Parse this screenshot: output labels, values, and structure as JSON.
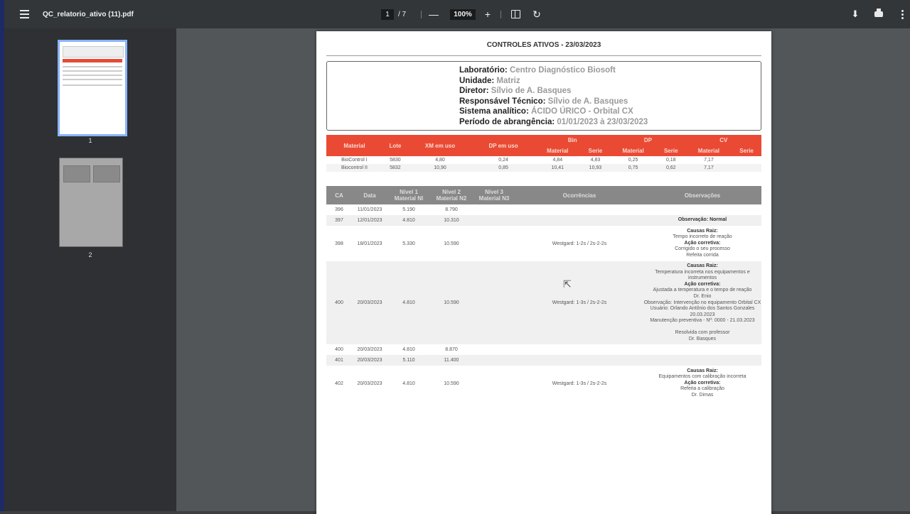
{
  "toolbar": {
    "filename": "QC_relatorio_ativo (11).pdf",
    "page_current": "1",
    "page_total": "/  7",
    "zoom": "100%",
    "minus": "—",
    "plus": "+",
    "rotate": "↻",
    "download": "⬇"
  },
  "thumbnails": [
    {
      "number": "1"
    },
    {
      "number": "2"
    }
  ],
  "document": {
    "title": "CONTROLES ATIVOS - 23/03/2023",
    "info": [
      {
        "label": "Laboratório:",
        "value": "Centro Diagnóstico Biosoft"
      },
      {
        "label": "Unidade:",
        "value": "Matriz"
      },
      {
        "label": "Diretor:",
        "value": "Sílvio de A. Basques"
      },
      {
        "label": "Responsável Técnico:",
        "value": "Sílvio de A. Basques"
      },
      {
        "label": "Sistema analítico:",
        "value": "ÁCIDO ÚRICO - Orbital CX"
      },
      {
        "label": "Período de abrangência:",
        "value": "01/01/2023 à 23/03/2023"
      }
    ],
    "control_table": {
      "headers": [
        "Material",
        "Lote",
        "XM em uso",
        "DP em uso"
      ],
      "group_headers": [
        "Bin",
        "DP",
        "CV"
      ],
      "sub_headers": [
        "Material",
        "Serie",
        "Material",
        "Serie",
        "Material",
        "Serie"
      ],
      "rows": [
        [
          "BioControl I",
          "5830",
          "4,80",
          "0,24",
          "4,84",
          "4,83",
          "0,25",
          "0,18",
          "7,17",
          ""
        ],
        [
          "Biocontrol II",
          "5832",
          "10,90",
          "0,85",
          "10,41",
          "10,93",
          "0,75",
          "0,62",
          "7,17",
          ""
        ]
      ]
    },
    "results_table": {
      "headers": [
        "CA",
        "Data",
        "Nível 1\nMaterial NI",
        "Nível 2\nMaterial N2",
        "Nível 3\nMaterial N3",
        "Ocorrências",
        "Observações"
      ],
      "rows": [
        {
          "ca": "396",
          "data": "11/01/2023",
          "n1": "5.190",
          "n2": "8.790",
          "n3": "",
          "oc": "",
          "obs": []
        },
        {
          "ca": "397",
          "data": "12/01/2023",
          "n1": "4.810",
          "n2": "10.310",
          "n3": "",
          "oc": "",
          "obs": [
            {
              "b": "Observação: Normal"
            }
          ]
        },
        {
          "ca": "398",
          "data": "18/01/2023",
          "n1": "5.330",
          "n2": "10.590",
          "n3": "",
          "oc": "Westgard: 1-2s / 2s-2-2s",
          "obs": [
            {
              "b": "Causas Raiz:"
            },
            {
              "t": "Tempo incorreto de reação"
            },
            {
              "b": "Ação corretiva:"
            },
            {
              "t": "Corrigido o seu processo"
            },
            {
              "t": "Refeita corrida"
            }
          ]
        },
        {
          "ca": "400",
          "data": "20/03/2023",
          "n1": "4.810",
          "n2": "10.590",
          "n3": "",
          "oc": "Westgard: 1-3s / 2s-2-2s",
          "obs": [
            {
              "b": "Causas Raiz:"
            },
            {
              "t": "Temperatura incorreta nos equipamentos e instrumentos"
            },
            {
              "b": "Ação corretiva:"
            },
            {
              "t": "Ajustada a temperatura e o tempo de reação"
            },
            {
              "t": "Dr. Enio"
            },
            {
              "t": "Observação: Intervenção no equipamento Orbital CX"
            },
            {
              "t": "Usuário: Orlando Antônio dos Santos Gonzales"
            },
            {
              "t": "20.03.2023"
            },
            {
              "t": "Manutenção preventiva - Nº: 0000 - 21.03.2023"
            },
            {
              "t": ""
            },
            {
              "t": "Resolvida com professor"
            },
            {
              "t": "Dr. Basques"
            }
          ]
        },
        {
          "ca": "400",
          "data": "20/03/2023",
          "n1": "4.810",
          "n2": "8.870",
          "n3": "",
          "oc": "",
          "obs": []
        },
        {
          "ca": "401",
          "data": "20/03/2023",
          "n1": "5.110",
          "n2": "11.400",
          "n3": "",
          "oc": "",
          "obs": []
        },
        {
          "ca": "402",
          "data": "20/03/2023",
          "n1": "4.810",
          "n2": "10.590",
          "n3": "",
          "oc": "Westgard: 1-3s / 2s-2-2s",
          "obs": [
            {
              "b": "Causas Raiz:"
            },
            {
              "t": "Equipamentos com calibração incorreta"
            },
            {
              "b": "Ação corretiva:"
            },
            {
              "t": "Refeita a calibração"
            },
            {
              "t": "Dr. Dimas"
            }
          ]
        }
      ]
    }
  }
}
